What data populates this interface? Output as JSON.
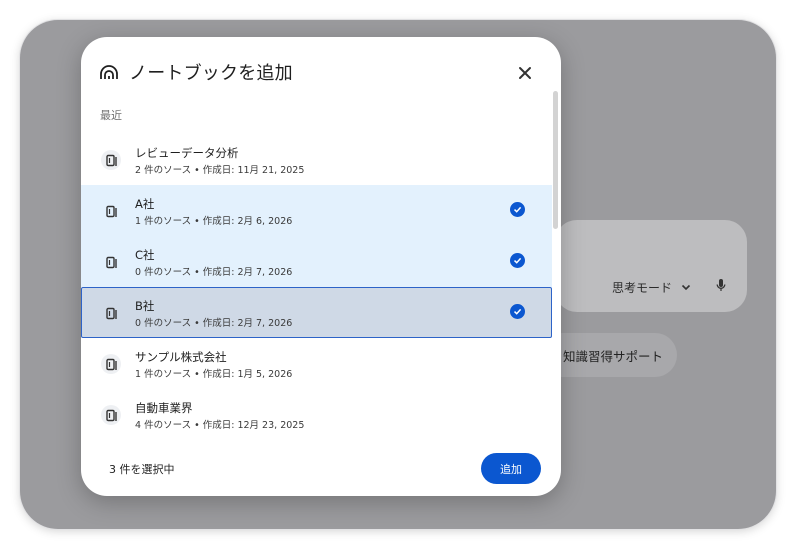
{
  "background": {
    "mode_label": "思考モード",
    "chip_label": "知識習得サポート"
  },
  "dialog": {
    "title": "ノートブックを追加",
    "section_label": "最近",
    "items": [
      {
        "title": "レビューデータ分析",
        "meta": "2 件のソース • 作成日: 11月 21, 2025",
        "selected": false
      },
      {
        "title": "A社",
        "meta": "1 件のソース • 作成日: 2月 6, 2026",
        "selected": true
      },
      {
        "title": "C社",
        "meta": "0 件のソース • 作成日: 2月 7, 2026",
        "selected": true
      },
      {
        "title": "B社",
        "meta": "0 件のソース • 作成日: 2月 7, 2026",
        "selected": true,
        "focused": true
      },
      {
        "title": "サンプル株式会社",
        "meta": "1 件のソース • 作成日: 1月 5, 2026",
        "selected": false
      },
      {
        "title": "自動車業界",
        "meta": "4 件のソース • 作成日: 12月 23, 2025",
        "selected": false
      }
    ],
    "selected_count_label": "3 件を選択中",
    "add_button_label": "追加"
  },
  "colors": {
    "accent": "#0b57d0",
    "selected_row": "#e3f1fd",
    "focused_row": "#cfd9e6"
  }
}
